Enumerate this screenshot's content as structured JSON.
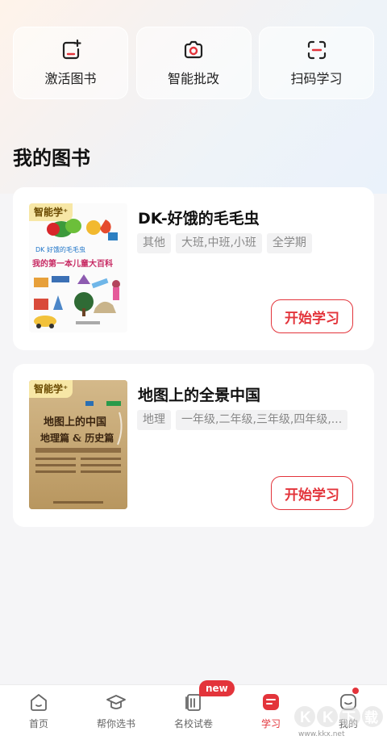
{
  "quick_actions": [
    {
      "label": "激活图书",
      "icon": "add-book-icon"
    },
    {
      "label": "智能批改",
      "icon": "camera-icon"
    },
    {
      "label": "扫码学习",
      "icon": "scan-icon"
    }
  ],
  "section_title": "我的图书",
  "books": [
    {
      "title": "DK-好饿的毛毛虫",
      "tags": [
        "其他",
        "大班,中班,小班",
        "全学期"
      ],
      "cover_badge": "智能学⁺",
      "cover_title": "我的第一本儿童大百科",
      "cover_subtitle": "DK 好饿的毛毛虫",
      "button_label": "开始学习"
    },
    {
      "title": "地图上的全景中国",
      "tags": [
        "地理",
        "一年级,二年级,三年级,四年级,..."
      ],
      "cover_badge": "智能学⁺",
      "cover_title_1": "地图上的中国",
      "cover_title_2": "地理篇 & 历史篇",
      "button_label": "开始学习"
    }
  ],
  "tabs": [
    {
      "label": "首页",
      "icon": "home-icon",
      "active": false
    },
    {
      "label": "帮你选书",
      "icon": "graduation-cap-icon",
      "active": false
    },
    {
      "label": "名校试卷",
      "icon": "exam-paper-icon",
      "active": false
    },
    {
      "label": "学习",
      "icon": "study-icon",
      "active": true
    },
    {
      "label": "我的",
      "icon": "profile-icon",
      "active": false
    }
  ],
  "new_badge": "new",
  "watermark": {
    "brand": "KK下载",
    "url": "www.kkx.net"
  },
  "colors": {
    "accent": "#e3343b",
    "badge_bg": "#f7e7a6"
  }
}
